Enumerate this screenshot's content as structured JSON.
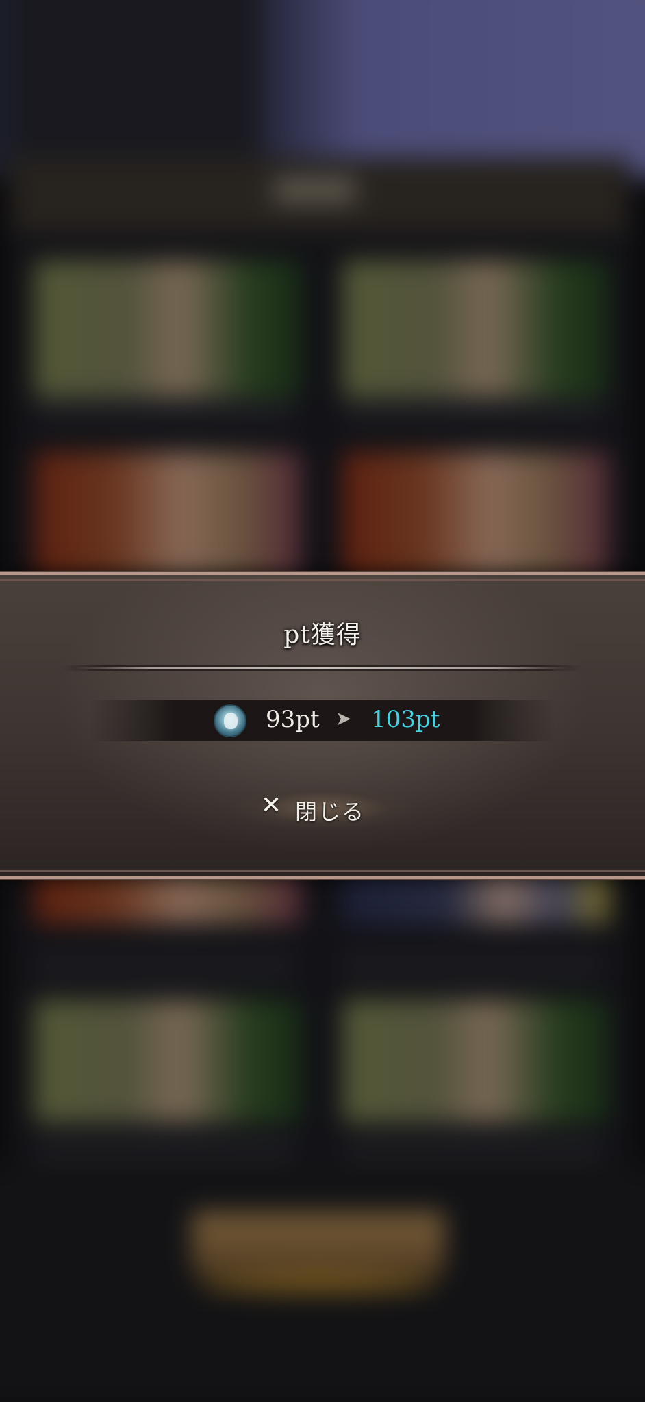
{
  "popup": {
    "title": "pt獲得",
    "points": {
      "icon": "pt-emblem-icon",
      "old_value": "93pt",
      "arrow": "➤",
      "new_value": "103pt",
      "new_value_color": "#40d4e4"
    },
    "close_button": {
      "icon": "close-icon",
      "x_glyph": "✕",
      "label": "閉じる"
    }
  },
  "colors": {
    "popup_border": "#b9988c",
    "popup_background": "#3d3431",
    "text": "#f2eee8"
  }
}
